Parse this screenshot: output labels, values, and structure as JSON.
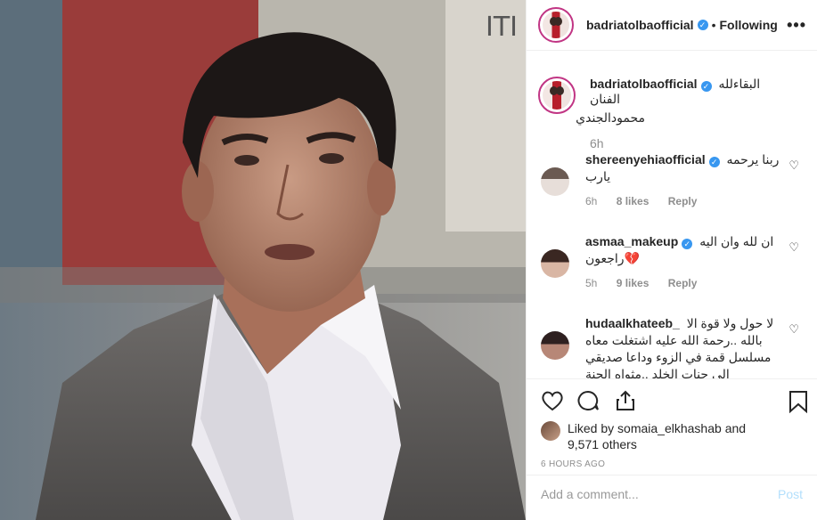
{
  "post": {
    "username": "badriatolbaofficial",
    "follow_status": "Following",
    "dot": "•",
    "more": "•••",
    "verified_mark": "✓"
  },
  "caption": {
    "username": "badriatolbaofficial",
    "text_line1": "البقاءلله الفنان",
    "text_line2": "محمودالجندي",
    "time": "6h"
  },
  "comments": [
    {
      "username": "shereenyehiaofficial",
      "text": "ربنا يرحمه يارب",
      "time": "6h",
      "likes": "8 likes",
      "reply": "Reply"
    },
    {
      "username": "asmaa_makeup",
      "text": "ان لله وان اليه راجعون💔",
      "time": "5h",
      "likes": "9 likes",
      "reply": "Reply"
    },
    {
      "username": "hudaalkhateeb_",
      "text": "لا حول ولا قوة الا بالله ..رحمة الله عليه اشتغلت معاه مسلسل قمة في الزوء وداعا صديقي الى جنات الخلد ..مثواه الجنة"
    }
  ],
  "liked": {
    "prefix": "Liked by",
    "user": "somaia_elkhashab",
    "and": "and",
    "count": "9,571 others"
  },
  "timestamp": "6 HOURS AGO",
  "add_comment": {
    "placeholder": "Add a comment...",
    "post": "Post"
  },
  "icons": {
    "like": "heart-icon",
    "comment": "comment-icon",
    "share": "share-icon",
    "save": "bookmark-icon",
    "more": "more-icon",
    "verified": "verified-icon"
  },
  "colors": {
    "verified": "#3897f0",
    "meta": "#8e8e8e",
    "post_disabled": "#b2dffc"
  }
}
